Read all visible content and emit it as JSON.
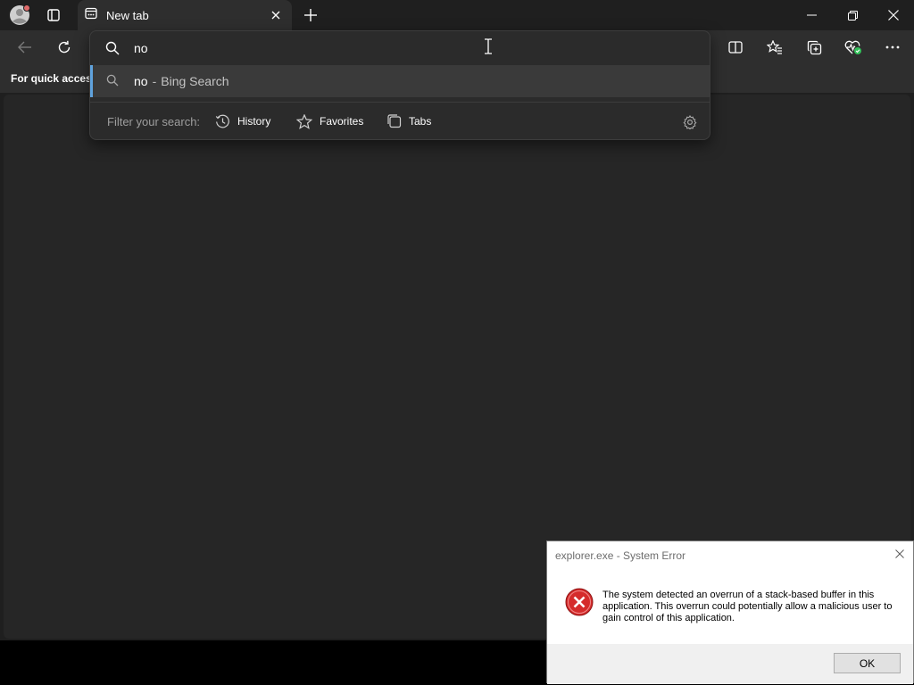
{
  "browser": {
    "tab": {
      "title": "New tab"
    },
    "favorites_bar": {
      "text": "For quick access"
    }
  },
  "omnibox": {
    "query": "no",
    "suggestion": {
      "query": "no",
      "separator": "-",
      "source": "Bing Search"
    },
    "filter": {
      "label": "Filter your search:",
      "chips": [
        "History",
        "Favorites",
        "Tabs"
      ]
    }
  },
  "error_dialog": {
    "title": "explorer.exe - System Error",
    "message": "The system detected an overrun of a stack-based buffer in this application. This overrun could potentially allow a malicious user to gain control of this application.",
    "ok_label": "OK"
  },
  "colors": {
    "accent": "#5fa2dd",
    "error_red": "#d52b2b",
    "health_green": "#33c15a"
  }
}
